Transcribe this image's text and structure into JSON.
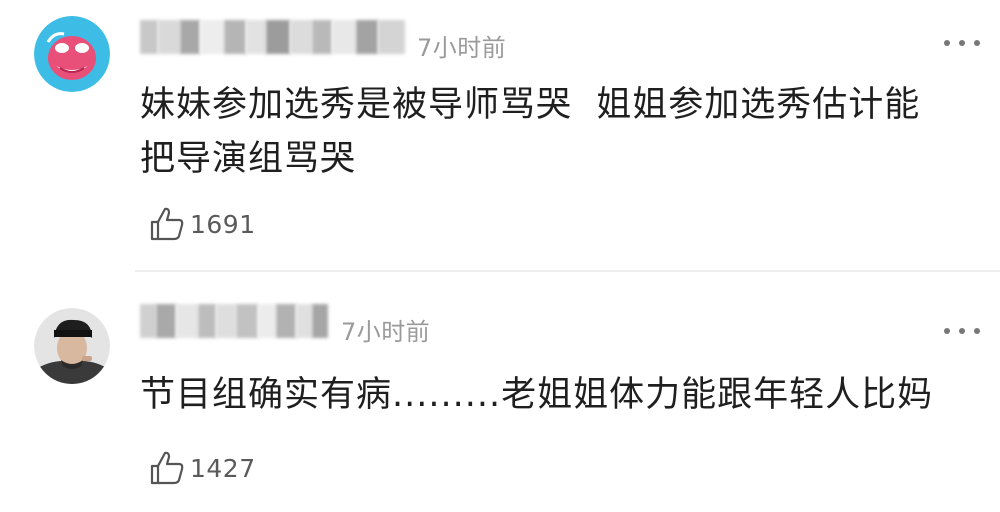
{
  "comments": [
    {
      "timestamp": "7小时前",
      "content": "妹妹参加选秀是被导师骂哭  姐姐参加选秀估计能\n把导演组骂哭",
      "like_count": "1691"
    },
    {
      "timestamp": "7小时前",
      "content": "节目组确实有病.........老姐姐体力能跟年轻人比妈",
      "like_count": "1427"
    }
  ],
  "icons": {
    "like": "thumbs-up-outline-icon",
    "more": "more-dots-icon"
  },
  "colors": {
    "timestamp": "#9a9a9a",
    "text": "#1f1f1f",
    "divider": "#eeeeee",
    "avatar1_bg": "#3dbde6",
    "avatar1_face": "#e8507a"
  }
}
